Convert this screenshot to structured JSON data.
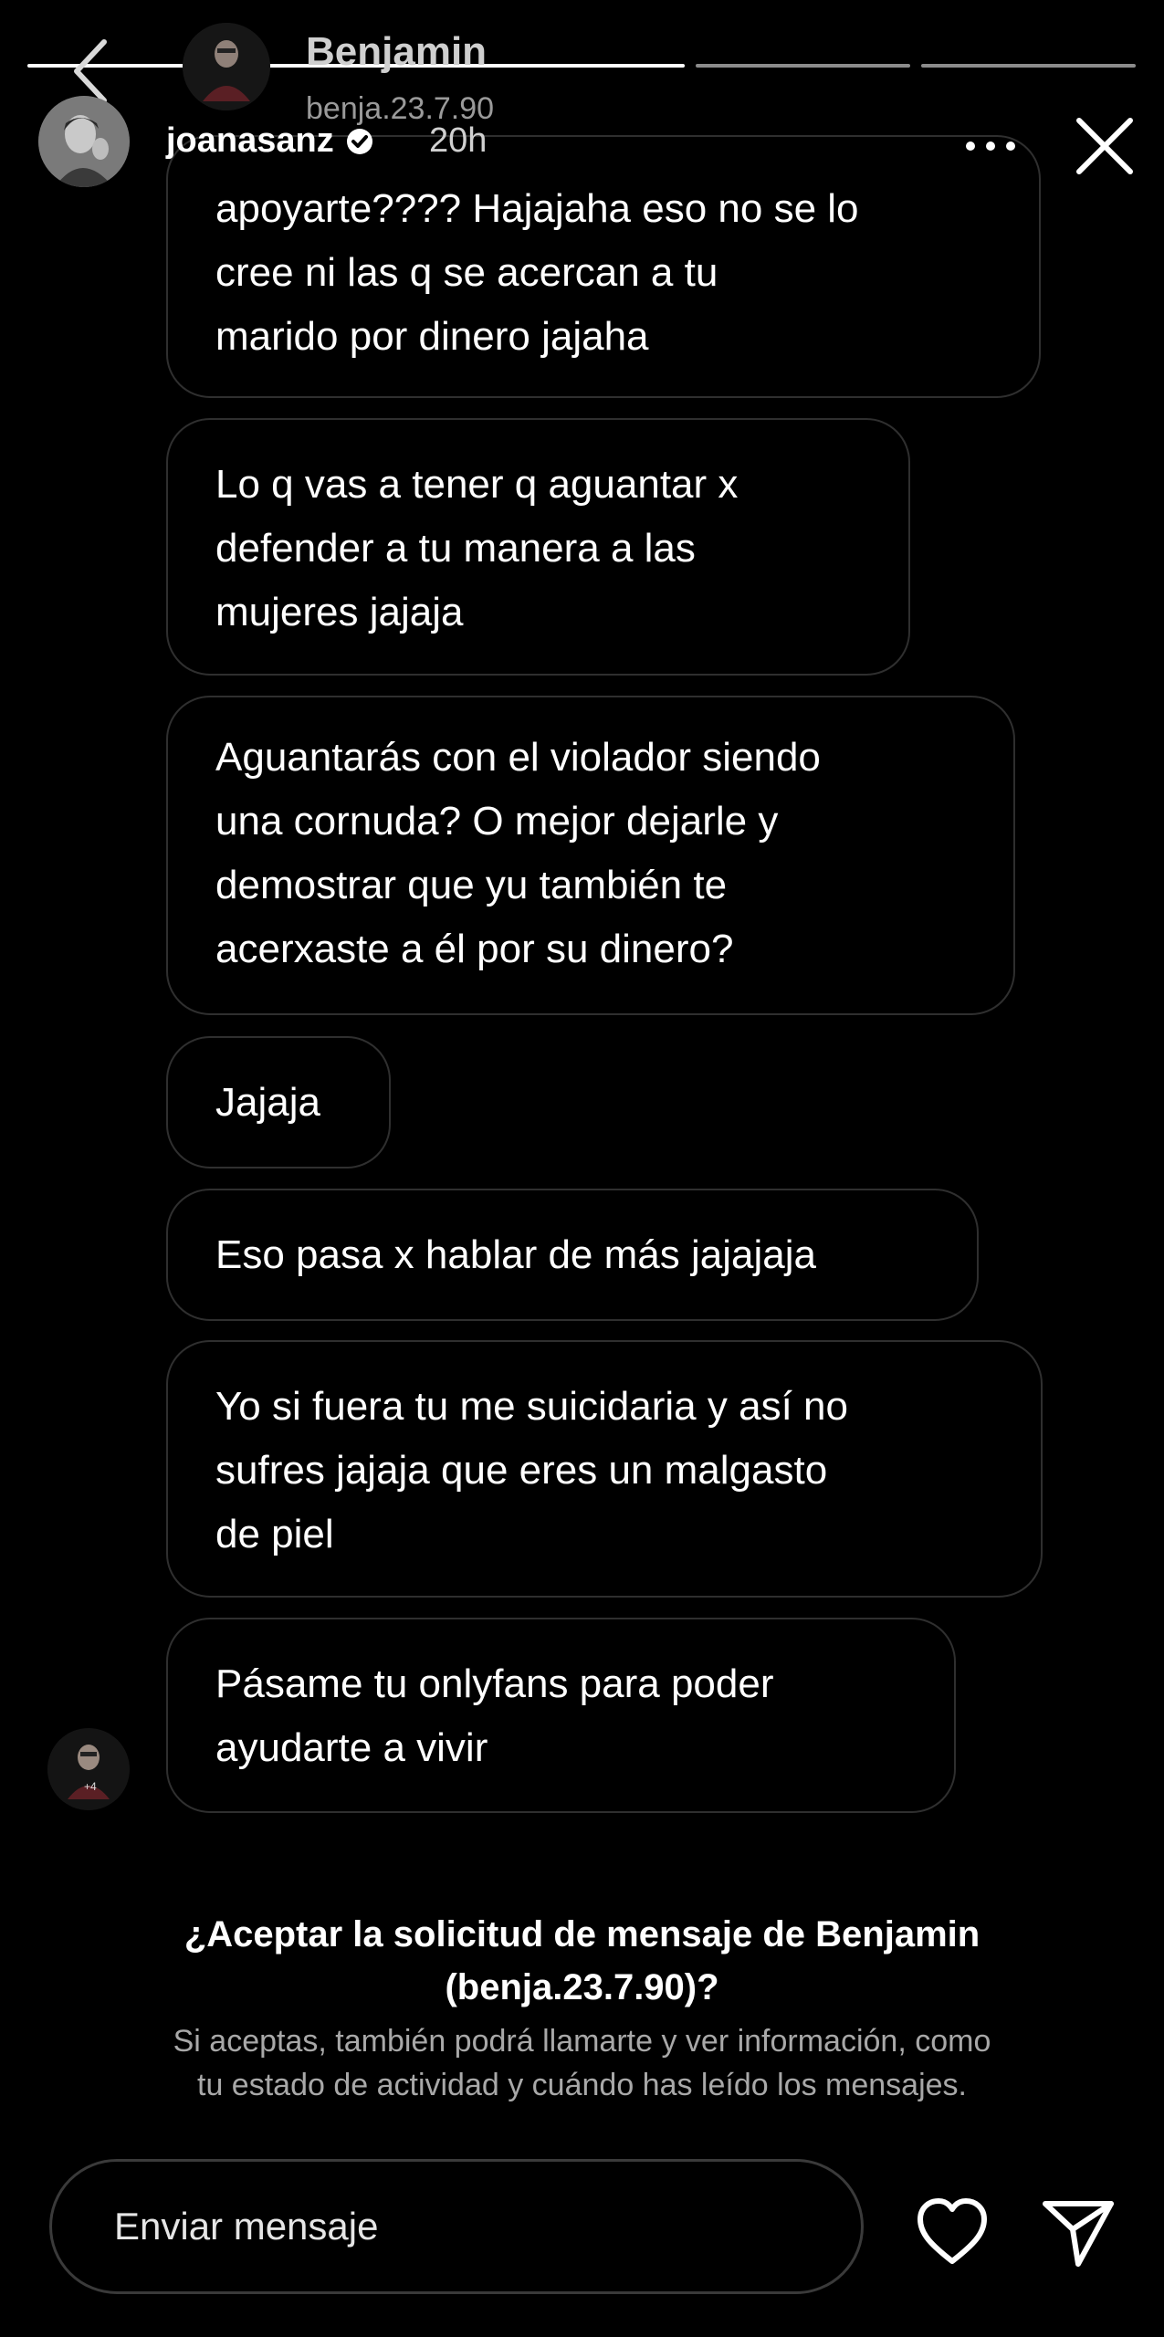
{
  "header": {
    "dm_name": "Benjamin",
    "dm_handle": "benja.23.7.90",
    "story_username": "joanasanz",
    "story_time": "20h"
  },
  "messages": [
    {
      "lines": [
        "apoyarte???? Hajajaha eso no se lo",
        "cree ni las q se acercan a tu",
        "marido por dinero jajaha"
      ]
    },
    {
      "lines": [
        "Lo q vas a tener q aguantar x",
        "defender a tu manera a las",
        "mujeres jajaja"
      ]
    },
    {
      "lines": [
        "Aguantarás con el violador siendo",
        "una cornuda? O mejor dejarle y",
        "demostrar que yu también te",
        "acerxaste a él por su dinero?"
      ]
    },
    {
      "lines": [
        "Jajaja"
      ]
    },
    {
      "lines": [
        "Eso pasa x hablar de más jajajaja"
      ]
    },
    {
      "lines": [
        "Yo si fuera tu me suicidaria y así no",
        "sufres jajaja que eres un malgasto",
        "de piel"
      ]
    },
    {
      "lines": [
        "Pásame tu onlyfans para poder",
        "ayudarte a vivir"
      ]
    }
  ],
  "request": {
    "title_line1": "¿Aceptar la solicitud de mensaje de Benjamin",
    "title_line2": "(benja.23.7.90)?",
    "desc_line1": "Si aceptas, también podrá llamarte y ver información, como",
    "desc_line2": "tu estado de actividad y cuándo has leído los mensajes."
  },
  "composer": {
    "placeholder": "Enviar mensaje"
  },
  "icons": {
    "back": "chevron-left-icon",
    "more": "more-horizontal-icon",
    "close": "close-icon",
    "verified": "verified-badge-icon",
    "like": "heart-icon",
    "send": "send-icon"
  },
  "colors": {
    "background": "#000000",
    "bubble_border": "#2f2f2f",
    "secondary_text": "#a8a8a8"
  }
}
